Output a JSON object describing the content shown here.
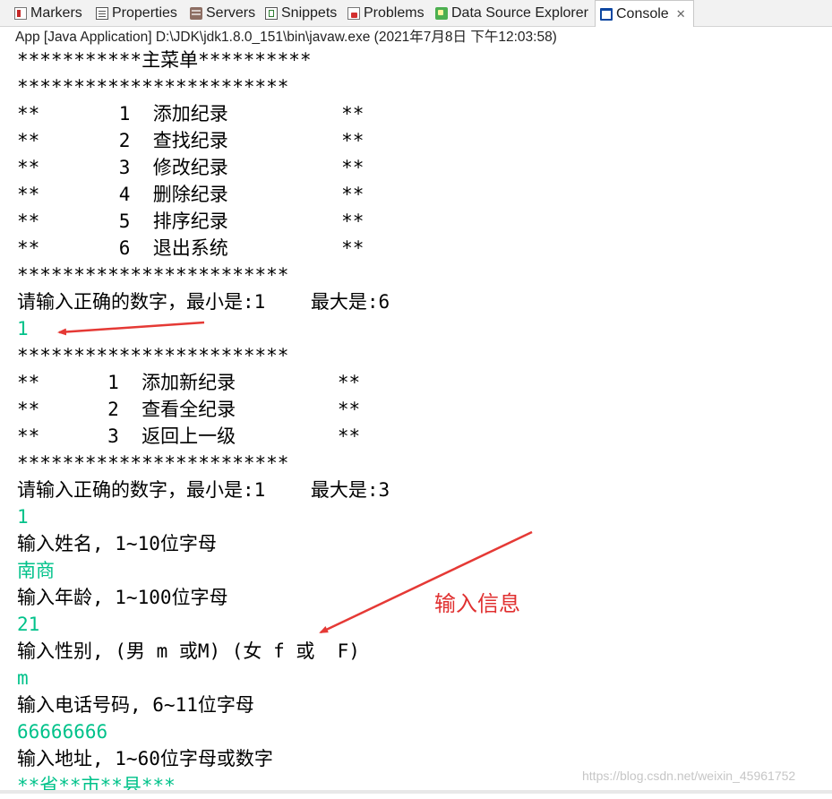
{
  "tabs": [
    {
      "label": "Markers",
      "icon": "markers-icon"
    },
    {
      "label": "Properties",
      "icon": "properties-icon"
    },
    {
      "label": "Servers",
      "icon": "servers-icon"
    },
    {
      "label": "Snippets",
      "icon": "snippets-icon"
    },
    {
      "label": "Problems",
      "icon": "problems-icon"
    },
    {
      "label": "Data Source Explorer",
      "icon": "data-source-explorer-icon"
    },
    {
      "label": "Console",
      "icon": "console-icon",
      "active": true
    }
  ],
  "close_glyph": "✕",
  "process_line": "App [Java Application] D:\\JDK\\jdk1.8.0_151\\bin\\javaw.exe (2021年7月8日 下午12:03:58)",
  "console": {
    "output_color": "#000000",
    "input_color": "#00c28a",
    "lines": [
      {
        "text": "***********主菜单**********",
        "type": "output"
      },
      {
        "text": "************************",
        "type": "output"
      },
      {
        "text": "**       1  添加纪录          **",
        "type": "output"
      },
      {
        "text": "**       2  查找纪录          **",
        "type": "output"
      },
      {
        "text": "**       3  修改纪录          **",
        "type": "output"
      },
      {
        "text": "**       4  删除纪录          **",
        "type": "output"
      },
      {
        "text": "**       5  排序纪录          **",
        "type": "output"
      },
      {
        "text": "**       6  退出系统          **",
        "type": "output"
      },
      {
        "text": "************************",
        "type": "output"
      },
      {
        "text": "请输入正确的数字，最小是:1    最大是:6",
        "type": "output"
      },
      {
        "text": "1",
        "type": "input"
      },
      {
        "text": "************************",
        "type": "output"
      },
      {
        "text": "**      1  添加新纪录         **",
        "type": "output"
      },
      {
        "text": "**      2  查看全纪录         **",
        "type": "output"
      },
      {
        "text": "**      3  返回上一级         **",
        "type": "output"
      },
      {
        "text": "************************",
        "type": "output"
      },
      {
        "text": "请输入正确的数字，最小是:1    最大是:3",
        "type": "output"
      },
      {
        "text": "1",
        "type": "input"
      },
      {
        "text": "输入姓名, 1~10位字母",
        "type": "output"
      },
      {
        "text": "南商",
        "type": "input"
      },
      {
        "text": "输入年龄, 1~100位字母",
        "type": "output"
      },
      {
        "text": "21",
        "type": "input"
      },
      {
        "text": "输入性别, (男 m 或M) (女 f 或  F)",
        "type": "output"
      },
      {
        "text": "m",
        "type": "input"
      },
      {
        "text": "输入电话号码, 6~11位字母",
        "type": "output"
      },
      {
        "text": "66666666",
        "type": "input"
      },
      {
        "text": "输入地址, 1~60位字母或数字",
        "type": "output"
      },
      {
        "text": "**省**市**县***",
        "type": "input"
      }
    ]
  },
  "annotation": {
    "text": "输入信息",
    "color": "#e03030"
  },
  "watermark": "https://blog.csdn.net/weixin_45961752"
}
